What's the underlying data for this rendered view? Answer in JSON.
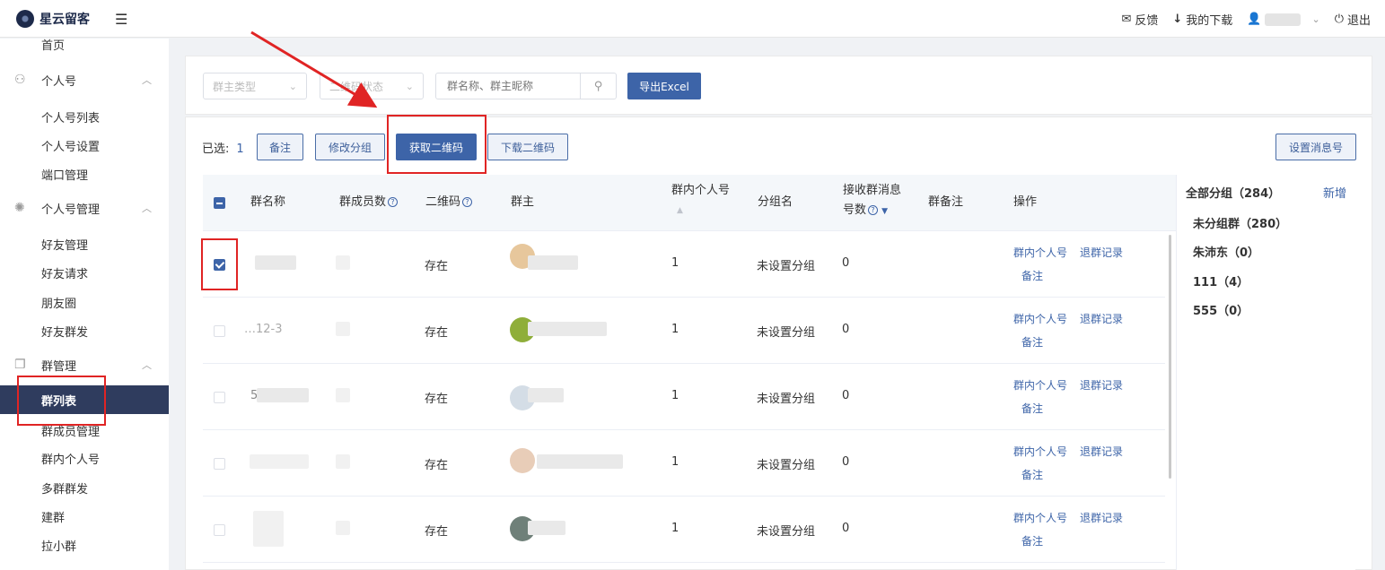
{
  "header": {
    "logo_text": "星云留客",
    "feedback_label": "反馈",
    "downloads_label": "我的下载",
    "logout_label": "退出"
  },
  "sidebar": {
    "top_partial": "首页",
    "groups": [
      {
        "label": "个人号",
        "items": [
          "个人号列表",
          "个人号设置",
          "端口管理"
        ]
      },
      {
        "label": "个人号管理",
        "items": [
          "好友管理",
          "好友请求",
          "朋友圈",
          "好友群发"
        ]
      },
      {
        "label": "群管理",
        "items": [
          "群列表",
          "群成员管理",
          "群内个人号",
          "多群群发",
          "建群",
          "拉小群"
        ]
      }
    ],
    "active_item": "群列表"
  },
  "filters": {
    "owner_type_placeholder": "群主类型",
    "qr_status_placeholder": "二维码状态",
    "search_placeholder": "群名称、群主昵称",
    "export_label": "导出Excel"
  },
  "toolbar": {
    "selected_label": "已选:",
    "selected_count": "1",
    "remark_label": "备注",
    "change_group_label": "修改分组",
    "get_qr_label": "获取二维码",
    "download_qr_label": "下载二维码",
    "set_msg_label": "设置消息号"
  },
  "table": {
    "headers": {
      "name": "群名称",
      "members": "群成员数",
      "qr": "二维码",
      "owner": "群主",
      "inner_accounts": "群内个人号",
      "group_name": "分组名",
      "receive_msg_1": "接收群消息",
      "receive_msg_2": "号数",
      "remark": "群备注",
      "actions": "操作"
    },
    "rows": [
      {
        "name_visible": "",
        "qr": "存在",
        "inner": "1",
        "group": "未设置分组",
        "receive": "0",
        "checked": true
      },
      {
        "name_visible": "…12-3",
        "qr": "存在",
        "inner": "1",
        "group": "未设置分组",
        "receive": "0",
        "checked": false
      },
      {
        "name_visible": "5",
        "qr": "存在",
        "inner": "1",
        "group": "未设置分组",
        "receive": "0",
        "checked": false
      },
      {
        "name_visible": "",
        "qr": "存在",
        "inner": "1",
        "group": "未设置分组",
        "receive": "0",
        "checked": false
      },
      {
        "name_visible": "",
        "qr": "存在",
        "inner": "1",
        "group": "未设置分组",
        "receive": "0",
        "checked": false
      }
    ],
    "action_links": {
      "inner": "群内个人号",
      "quit": "退群记录",
      "remark": "备注"
    }
  },
  "group_panel": {
    "title": "全部分组（284）",
    "add_label": "新增",
    "items": [
      "未分组群（280）",
      "朱沛东（0）",
      "111（4）",
      "555（0）"
    ]
  },
  "colors": {
    "primary": "#3d64a8",
    "sidebar_active": "#2f3c5e",
    "annotation_red": "#e02424"
  }
}
